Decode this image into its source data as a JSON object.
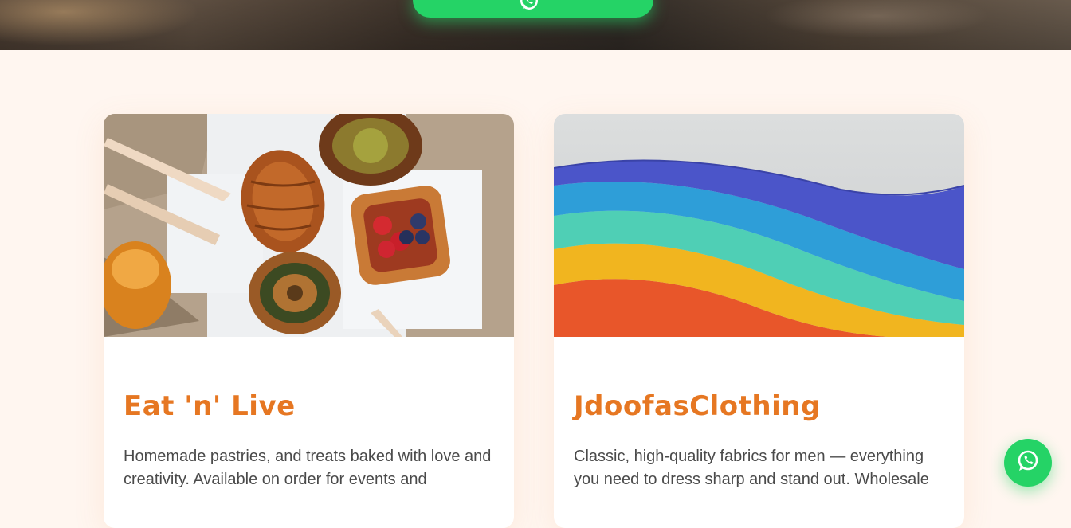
{
  "hero": {
    "button_label": "",
    "button_icon": "whatsapp-icon"
  },
  "cards": [
    {
      "title": "Eat 'n' Live",
      "description": "Homemade pastries, and treats baked with love and creativity. Available on order for events and",
      "image": "pastries-photo"
    },
    {
      "title": "JdoofasClothing",
      "description": "Classic, high-quality fabrics for men — everything you need to dress sharp and stand out. Wholesale",
      "image": "folded-fabrics-photo"
    }
  ],
  "floating_button": {
    "icon": "whatsapp-icon",
    "color": "#25d366"
  },
  "colors": {
    "accent": "#e67722",
    "whatsapp": "#25d366",
    "page_bg": "#fff6f0"
  }
}
